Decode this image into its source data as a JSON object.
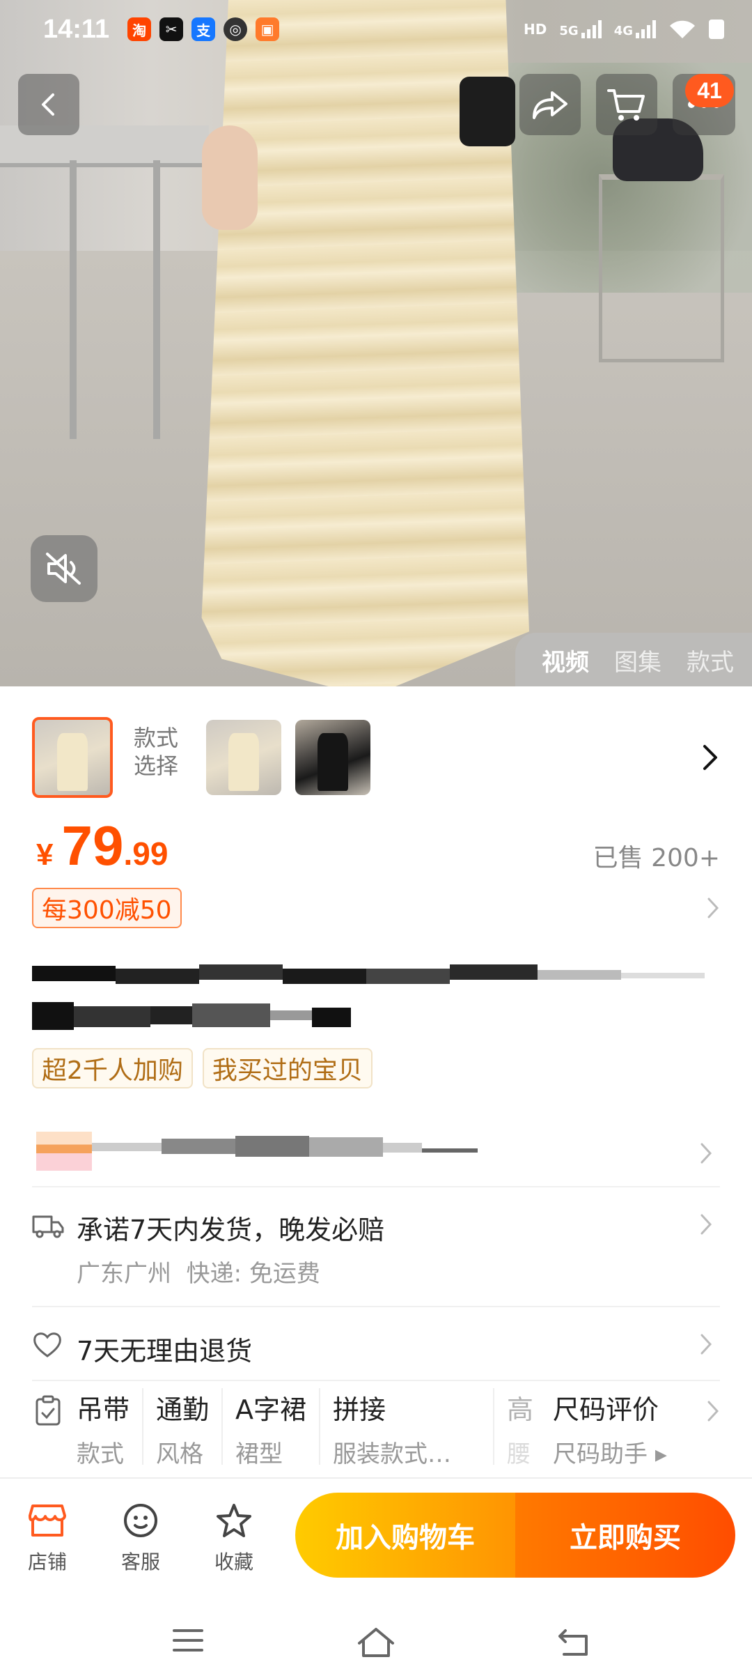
{
  "status": {
    "time": "14:11",
    "hd": "HD",
    "net1": "5G",
    "net2": "4G"
  },
  "cart_badge": "41",
  "media_tabs": [
    {
      "label": "视频"
    },
    {
      "label": "图集"
    },
    {
      "label": "款式"
    }
  ],
  "style_select_label": "款式\n选择",
  "price": {
    "currency": "¥",
    "integer": "79",
    "decimal": ".99"
  },
  "sold": "已售 200+",
  "promo": "每300减50",
  "tags": [
    "超2千人加购",
    "我买过的宝贝"
  ],
  "shipping": {
    "title": "承诺7天内发货，晚发必赔",
    "detail": "广东广州  快递: 免运费"
  },
  "returns": "7天无理由退货",
  "attributes": [
    {
      "value": "吊带",
      "name": "款式"
    },
    {
      "value": "通勤",
      "name": "风格"
    },
    {
      "value": "A字裙",
      "name": "裙型"
    },
    {
      "value": "拼接",
      "name": "服装款式…"
    },
    {
      "value": "高",
      "name": "腰"
    }
  ],
  "size_review": {
    "title": "尺码评价",
    "sub": "尺码助手 ▸"
  },
  "bottom": {
    "shop": "店铺",
    "service": "客服",
    "favorite": "收藏",
    "add_to_cart": "加入购物车",
    "buy_now": "立即购买"
  },
  "colors": {
    "accent": "#ff5000",
    "cart_yellow": "#ffb300",
    "buy_orange": "#ff5a00"
  }
}
